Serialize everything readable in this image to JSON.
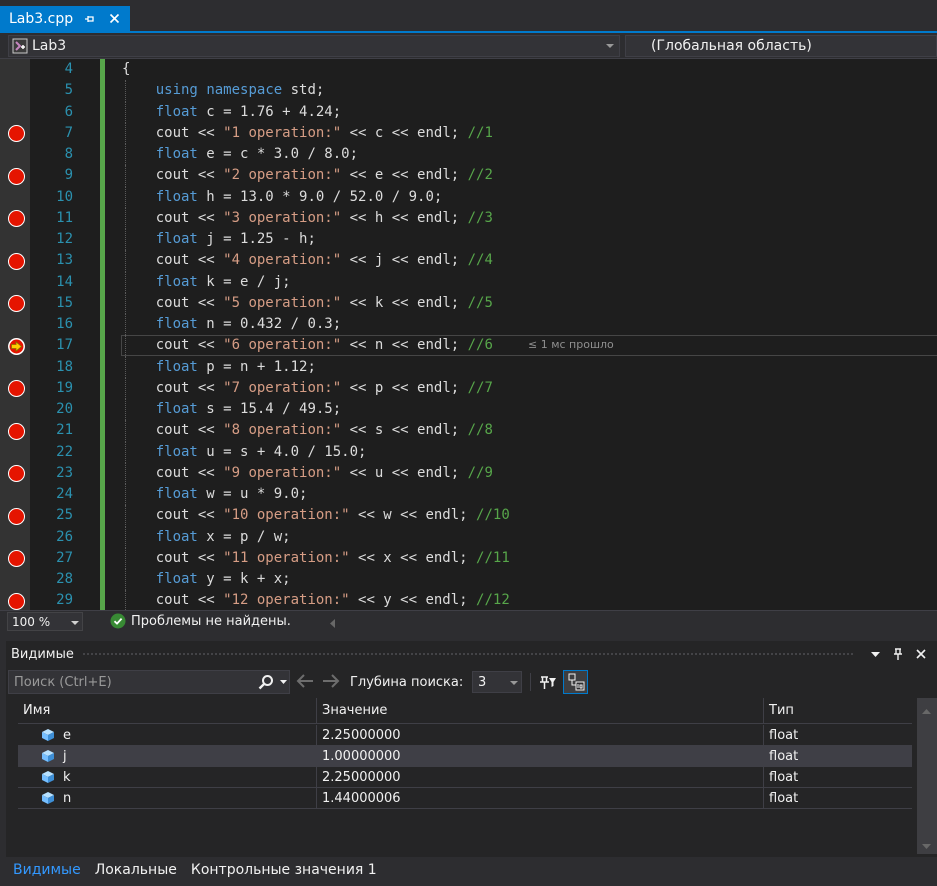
{
  "tab": {
    "label": "Lab3.cpp"
  },
  "nav": {
    "scope": "Lab3",
    "global": "(Глобальная область)"
  },
  "editor": {
    "lines": [
      {
        "num": "4",
        "bp": "none",
        "parts": [
          {
            "t": "{",
            "c": "p"
          }
        ]
      },
      {
        "num": "5",
        "bp": "none",
        "parts": [
          {
            "t": "    ",
            "c": "p"
          },
          {
            "t": "using",
            "c": "kw"
          },
          {
            "t": " ",
            "c": "p"
          },
          {
            "t": "namespace",
            "c": "kw"
          },
          {
            "t": " std;",
            "c": "p"
          }
        ]
      },
      {
        "num": "6",
        "bp": "none",
        "parts": [
          {
            "t": "    ",
            "c": "p"
          },
          {
            "t": "float",
            "c": "kw"
          },
          {
            "t": " c = 1.76 + 4.24;",
            "c": "p"
          }
        ]
      },
      {
        "num": "7",
        "bp": "bp",
        "parts": [
          {
            "t": "    cout << ",
            "c": "p"
          },
          {
            "t": "\"1 operation:\"",
            "c": "str"
          },
          {
            "t": " << c << endl; ",
            "c": "p"
          },
          {
            "t": "//1",
            "c": "cm"
          }
        ]
      },
      {
        "num": "8",
        "bp": "none",
        "parts": [
          {
            "t": "    ",
            "c": "p"
          },
          {
            "t": "float",
            "c": "kw"
          },
          {
            "t": " e = c * 3.0 / 8.0;",
            "c": "p"
          }
        ]
      },
      {
        "num": "9",
        "bp": "bp",
        "parts": [
          {
            "t": "    cout << ",
            "c": "p"
          },
          {
            "t": "\"2 operation:\"",
            "c": "str"
          },
          {
            "t": " << e << endl; ",
            "c": "p"
          },
          {
            "t": "//2",
            "c": "cm"
          }
        ]
      },
      {
        "num": "10",
        "bp": "none",
        "parts": [
          {
            "t": "    ",
            "c": "p"
          },
          {
            "t": "float",
            "c": "kw"
          },
          {
            "t": " h = 13.0 * 9.0 / 52.0 / 9.0;",
            "c": "p"
          }
        ]
      },
      {
        "num": "11",
        "bp": "bp",
        "parts": [
          {
            "t": "    cout << ",
            "c": "p"
          },
          {
            "t": "\"3 operation:\"",
            "c": "str"
          },
          {
            "t": " << h << endl; ",
            "c": "p"
          },
          {
            "t": "//3",
            "c": "cm"
          }
        ]
      },
      {
        "num": "12",
        "bp": "none",
        "parts": [
          {
            "t": "    ",
            "c": "p"
          },
          {
            "t": "float",
            "c": "kw"
          },
          {
            "t": " j = 1.25 - h;",
            "c": "p"
          }
        ]
      },
      {
        "num": "13",
        "bp": "bp",
        "parts": [
          {
            "t": "    cout << ",
            "c": "p"
          },
          {
            "t": "\"4 operation:\"",
            "c": "str"
          },
          {
            "t": " << j << endl; ",
            "c": "p"
          },
          {
            "t": "//4",
            "c": "cm"
          }
        ]
      },
      {
        "num": "14",
        "bp": "none",
        "parts": [
          {
            "t": "    ",
            "c": "p"
          },
          {
            "t": "float",
            "c": "kw"
          },
          {
            "t": " k = e / j;",
            "c": "p"
          }
        ]
      },
      {
        "num": "15",
        "bp": "bp",
        "parts": [
          {
            "t": "    cout << ",
            "c": "p"
          },
          {
            "t": "\"5 operation:\"",
            "c": "str"
          },
          {
            "t": " << k << endl; ",
            "c": "p"
          },
          {
            "t": "//5",
            "c": "cm"
          }
        ]
      },
      {
        "num": "16",
        "bp": "none",
        "parts": [
          {
            "t": "    ",
            "c": "p"
          },
          {
            "t": "float",
            "c": "kw"
          },
          {
            "t": " n = 0.432 / 0.3;",
            "c": "p"
          }
        ]
      },
      {
        "num": "17",
        "bp": "current",
        "current": true,
        "perftip": "≤ 1 мс прошло",
        "parts": [
          {
            "t": "    cout << ",
            "c": "p"
          },
          {
            "t": "\"6 operation:\"",
            "c": "str"
          },
          {
            "t": " << n << endl; ",
            "c": "p"
          },
          {
            "t": "//6",
            "c": "cm"
          }
        ]
      },
      {
        "num": "18",
        "bp": "none",
        "parts": [
          {
            "t": "    ",
            "c": "p"
          },
          {
            "t": "float",
            "c": "kw"
          },
          {
            "t": " p = n + 1.12;",
            "c": "p"
          }
        ]
      },
      {
        "num": "19",
        "bp": "bp",
        "parts": [
          {
            "t": "    cout << ",
            "c": "p"
          },
          {
            "t": "\"7 operation:\"",
            "c": "str"
          },
          {
            "t": " << p << endl; ",
            "c": "p"
          },
          {
            "t": "//7",
            "c": "cm"
          }
        ]
      },
      {
        "num": "20",
        "bp": "none",
        "parts": [
          {
            "t": "    ",
            "c": "p"
          },
          {
            "t": "float",
            "c": "kw"
          },
          {
            "t": " s = 15.4 / 49.5;",
            "c": "p"
          }
        ]
      },
      {
        "num": "21",
        "bp": "bp",
        "parts": [
          {
            "t": "    cout << ",
            "c": "p"
          },
          {
            "t": "\"8 operation:\"",
            "c": "str"
          },
          {
            "t": " << s << endl; ",
            "c": "p"
          },
          {
            "t": "//8",
            "c": "cm"
          }
        ]
      },
      {
        "num": "22",
        "bp": "none",
        "parts": [
          {
            "t": "    ",
            "c": "p"
          },
          {
            "t": "float",
            "c": "kw"
          },
          {
            "t": " u = s + 4.0 / 15.0;",
            "c": "p"
          }
        ]
      },
      {
        "num": "23",
        "bp": "bp",
        "parts": [
          {
            "t": "    cout << ",
            "c": "p"
          },
          {
            "t": "\"9 operation:\"",
            "c": "str"
          },
          {
            "t": " << u << endl; ",
            "c": "p"
          },
          {
            "t": "//9",
            "c": "cm"
          }
        ]
      },
      {
        "num": "24",
        "bp": "none",
        "parts": [
          {
            "t": "    ",
            "c": "p"
          },
          {
            "t": "float",
            "c": "kw"
          },
          {
            "t": " w = u * 9.0;",
            "c": "p"
          }
        ]
      },
      {
        "num": "25",
        "bp": "bp",
        "parts": [
          {
            "t": "    cout << ",
            "c": "p"
          },
          {
            "t": "\"10 operation:\"",
            "c": "str"
          },
          {
            "t": " << w << endl; ",
            "c": "p"
          },
          {
            "t": "//10",
            "c": "cm"
          }
        ]
      },
      {
        "num": "26",
        "bp": "none",
        "parts": [
          {
            "t": "    ",
            "c": "p"
          },
          {
            "t": "float",
            "c": "kw"
          },
          {
            "t": " x = p / w;",
            "c": "p"
          }
        ]
      },
      {
        "num": "27",
        "bp": "bp",
        "parts": [
          {
            "t": "    cout << ",
            "c": "p"
          },
          {
            "t": "\"11 operation:\"",
            "c": "str"
          },
          {
            "t": " << x << endl; ",
            "c": "p"
          },
          {
            "t": "//11",
            "c": "cm"
          }
        ]
      },
      {
        "num": "28",
        "bp": "none",
        "parts": [
          {
            "t": "    ",
            "c": "p"
          },
          {
            "t": "float",
            "c": "kw"
          },
          {
            "t": " y = k + x;",
            "c": "p"
          }
        ]
      },
      {
        "num": "29",
        "bp": "bp",
        "parts": [
          {
            "t": "    cout << ",
            "c": "p"
          },
          {
            "t": "\"12 operation:\"",
            "c": "str"
          },
          {
            "t": " << y << endl; ",
            "c": "p"
          },
          {
            "t": "//12",
            "c": "cm"
          }
        ]
      }
    ]
  },
  "status": {
    "zoom": "100 %",
    "issues": "Проблемы не найдены."
  },
  "autos": {
    "title": "Видимые",
    "search_placeholder": "Поиск (Ctrl+E)",
    "depth_label": "Глубина поиска:",
    "depth_value": "3",
    "columns": {
      "name": "Имя",
      "value": "Значение",
      "type": "Тип"
    },
    "rows": [
      {
        "name": "e",
        "value": "2.25000000",
        "type": "float",
        "selected": false
      },
      {
        "name": "j",
        "value": "1.00000000",
        "type": "float",
        "selected": true
      },
      {
        "name": "k",
        "value": "2.25000000",
        "type": "float",
        "selected": false
      },
      {
        "name": "n",
        "value": "1.44000006",
        "type": "float",
        "selected": false
      }
    ]
  },
  "bottom_tabs": [
    {
      "label": "Видимые",
      "active": true
    },
    {
      "label": "Локальные",
      "active": false
    },
    {
      "label": "Контрольные значения 1",
      "active": false
    }
  ],
  "colors": {
    "accent": "#007acc",
    "breakpoint": "#e51400",
    "keyword": "#569cd6",
    "string": "#d69d85",
    "comment": "#57a64a",
    "line_number": "#2b91af",
    "changed_bar": "#57a64a",
    "active_tab_text": "#3399ff"
  },
  "icons": {
    "pin": "pin-icon",
    "close": "close-icon",
    "project": "cpp-project-icon",
    "breakpoint": "breakpoint-icon",
    "instruction_pointer": "instruction-pointer-icon",
    "ok": "check-circle-icon",
    "search": "search-icon",
    "variable": "field-cube-icon"
  }
}
